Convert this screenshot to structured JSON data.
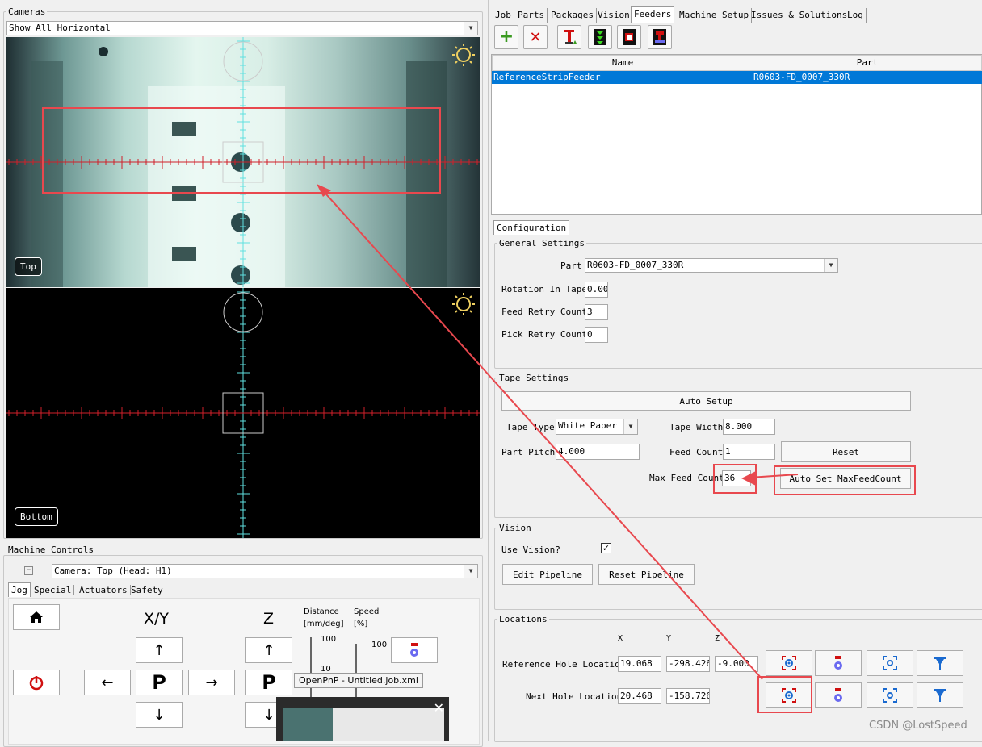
{
  "cameras": {
    "title": "Cameras",
    "view_mode": "Show All Horizontal",
    "top_label": "Top",
    "bottom_label": "Bottom"
  },
  "machine_controls": {
    "title": "Machine Controls",
    "camera_select": "Camera: Top (Head: H1)",
    "collapse_icon": "minus-icon",
    "tabs": [
      "Jog",
      "Special",
      "Actuators",
      "Safety"
    ],
    "xy_label": "X/Y",
    "z_label": "Z",
    "distance_label": "Distance",
    "distance_unit": "[mm/deg]",
    "speed_label": "Speed",
    "speed_unit": "[%]",
    "distance_tick_top": "100",
    "distance_tick_mid": "10",
    "speed_tick_top": "100",
    "park_label": "P",
    "tooltip": "OpenPnP - Untitled.job.xml"
  },
  "main_tabs": [
    "Job",
    "Parts",
    "Packages",
    "Vision",
    "Feeders",
    "Machine Setup",
    "Issues & Solutions",
    "Log"
  ],
  "active_tab": "Feeders",
  "feeders_table": {
    "columns": [
      "Name",
      "Part"
    ],
    "rows": [
      {
        "name": "ReferenceStripFeeder",
        "part": "R0603-FD_0007_330R"
      }
    ]
  },
  "configuration": {
    "tab_label": "Configuration",
    "general_title": "General Settings",
    "part_label": "Part",
    "part_value": "R0603-FD_0007_330R",
    "rotation_label": "Rotation In Tape",
    "rotation_value": "0.00",
    "feed_retry_label": "Feed Retry Count",
    "feed_retry_value": "3",
    "pick_retry_label": "Pick Retry Count",
    "pick_retry_value": "0",
    "tape_title": "Tape Settings",
    "auto_setup_label": "Auto Setup",
    "tape_type_label": "Tape Type",
    "tape_type_value": "White Paper",
    "tape_width_label": "Tape Width",
    "tape_width_value": "8.000",
    "part_pitch_label": "Part Pitch",
    "part_pitch_value": "4.000",
    "feed_count_label": "Feed Count",
    "feed_count_value": "1",
    "reset_label": "Reset",
    "max_feed_label": "Max Feed Count",
    "max_feed_value": "36",
    "auto_set_max_label": "Auto Set MaxFeedCount",
    "vision_title": "Vision",
    "use_vision_label": "Use Vision?",
    "use_vision_checked": true,
    "edit_pipeline_label": "Edit Pipeline",
    "reset_pipeline_label": "Reset Pipeline",
    "locations_title": "Locations",
    "col_x": "X",
    "col_y": "Y",
    "col_z": "Z",
    "ref_hole_label": "Reference Hole Location",
    "ref_hole_x": "19.068",
    "ref_hole_y": "-298.426",
    "ref_hole_z": "-9.000",
    "next_hole_label": "Next Hole Location",
    "next_hole_x": "20.468",
    "next_hole_y": "-158.726"
  },
  "watermark": "CSDN @LostSpeed",
  "colors": {
    "highlight_red": "#e8484e",
    "selection_blue": "#0078d7",
    "reticle_red": "#d0202a",
    "reticle_cyan": "#5fe0e0"
  }
}
